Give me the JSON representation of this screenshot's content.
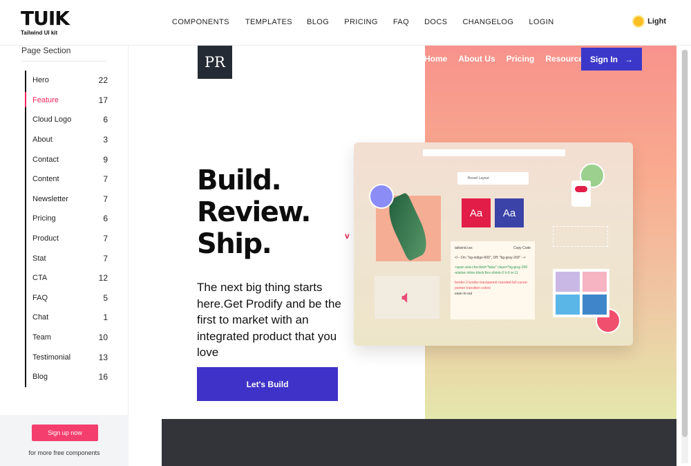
{
  "header": {
    "logo_text": "TUIK",
    "logo_subtitle": "Tailwind UI kit",
    "nav": [
      "COMPONENTS",
      "TEMPLATES",
      "BLOG",
      "PRICING",
      "FAQ",
      "DOCS",
      "CHANGELOG",
      "LOGIN"
    ],
    "theme_label": "Light"
  },
  "sidebar": {
    "section_title": "Page Section",
    "active_item": "Feature",
    "items": [
      {
        "label": "Hero",
        "count": "22"
      },
      {
        "label": "Feature",
        "count": "17"
      },
      {
        "label": "Cloud Logo",
        "count": "6"
      },
      {
        "label": "About",
        "count": "3"
      },
      {
        "label": "Contact",
        "count": "9"
      },
      {
        "label": "Content",
        "count": "7"
      },
      {
        "label": "Newsletter",
        "count": "7"
      },
      {
        "label": "Pricing",
        "count": "6"
      },
      {
        "label": "Product",
        "count": "7"
      },
      {
        "label": "Stat",
        "count": "7"
      },
      {
        "label": "CTA",
        "count": "12"
      },
      {
        "label": "FAQ",
        "count": "5"
      },
      {
        "label": "Chat",
        "count": "1"
      },
      {
        "label": "Team",
        "count": "10"
      },
      {
        "label": "Testimonial",
        "count": "13"
      },
      {
        "label": "Blog",
        "count": "16"
      }
    ],
    "promo_button": "Sign up now",
    "promo_note": "for more free components"
  },
  "preview": {
    "logo": "PR",
    "nav": [
      "Home",
      "About Us",
      "Pricing",
      "Resources"
    ],
    "sign_in": "Sign In",
    "headline_1": "Build.",
    "headline_2": "Review.",
    "headline_3": "Ship.",
    "subtext": "The next big thing starts here.Get Prodify and be the first to market with an integrated product that you love",
    "cta": "Let's Build",
    "mock": {
      "search": "Boxed Layout",
      "aa_1": "Aa",
      "aa_2": "Aa",
      "code_title": "tailwind.css",
      "code_copy": "Copy Code",
      "code_line_1": "<!-- On: \"bg-indigo-600\", Off: \"bg-gray-200\" -->",
      "code_line_2": "<span aria-checked=\"false\" class=\"bg-gray-200 relative inline-block flex-shrink-0 h-6 w-11",
      "code_line_3": "border-2 border-transparent rounded-full cursor-pointer transition-colors",
      "code_line_4": "ease-in-out"
    }
  },
  "colors": {
    "accent": "#f0245e",
    "brand_purple": "#3f32c8",
    "footer": "#33343a"
  }
}
